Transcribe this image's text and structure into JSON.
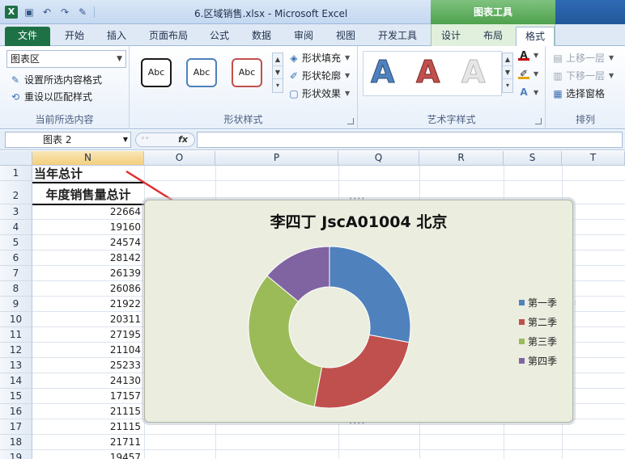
{
  "titlebar": {
    "app_icon_letter": "X",
    "title": "6.区域销售.xlsx - Microsoft Excel",
    "context_tools": "图表工具"
  },
  "tabs": {
    "file": "文件",
    "items": [
      "开始",
      "插入",
      "页面布局",
      "公式",
      "数据",
      "审阅",
      "视图",
      "开发工具",
      "设计",
      "布局",
      "格式"
    ]
  },
  "ribbon": {
    "current_selection": {
      "combo_value": "图表区",
      "format_selection": "设置所选内容格式",
      "reset_style": "重设以匹配样式",
      "label": "当前所选内容"
    },
    "shape_styles": {
      "sample_text": "Abc",
      "fill": "形状填充",
      "outline": "形状轮廓",
      "effects": "形状效果",
      "label": "形状样式",
      "colors": [
        "#1a1a1a",
        "#4f81bd",
        "#c0504d"
      ]
    },
    "wordart": {
      "letter": "A",
      "label": "艺术字样式",
      "colors": [
        "#4f81bd",
        "#c0504d",
        "#e6e6e6"
      ],
      "fill_color": "#c00000",
      "outline_color": "#e6a200"
    },
    "arrange": {
      "bring_forward": "上移一层",
      "send_backward": "下移一层",
      "selection_pane": "选择窗格",
      "label": "排列"
    }
  },
  "formula_bar": {
    "name_box": "图表 2",
    "fx": "fx",
    "formula": ""
  },
  "sheet": {
    "columns": [
      "N",
      "O",
      "P",
      "Q",
      "R",
      "S",
      "T"
    ],
    "row_numbers": [
      "1",
      "2",
      "3",
      "4",
      "5",
      "6",
      "7",
      "8",
      "9",
      "10",
      "11",
      "12",
      "13",
      "14",
      "15",
      "16",
      "17",
      "18",
      "19"
    ],
    "n1": "当年总计",
    "n2": "年度销售量总计",
    "values": [
      "22664",
      "19160",
      "24574",
      "28142",
      "26139",
      "26086",
      "21922",
      "20311",
      "27195",
      "21104",
      "25233",
      "24130",
      "17157",
      "21115",
      "21115",
      "21711",
      "19457"
    ]
  },
  "chart_data": {
    "type": "pie",
    "title": "李四丁 JscA01004 北京",
    "categories": [
      "第一季",
      "第二季",
      "第三季",
      "第四季"
    ],
    "values": [
      28,
      25,
      33,
      14
    ],
    "colors": [
      "#4f81bd",
      "#c0504d",
      "#9bbb59",
      "#8064a2"
    ],
    "donut": true,
    "legend": "right"
  }
}
